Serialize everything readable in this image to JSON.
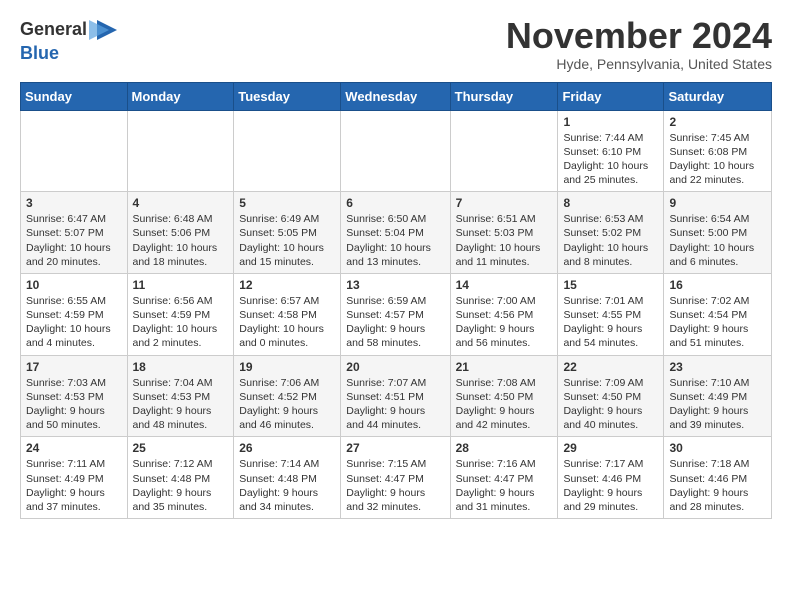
{
  "header": {
    "logo_general": "General",
    "logo_blue": "Blue",
    "month_title": "November 2024",
    "subtitle": "Hyde, Pennsylvania, United States"
  },
  "columns": [
    "Sunday",
    "Monday",
    "Tuesday",
    "Wednesday",
    "Thursday",
    "Friday",
    "Saturday"
  ],
  "weeks": [
    [
      {
        "day": "",
        "content": ""
      },
      {
        "day": "",
        "content": ""
      },
      {
        "day": "",
        "content": ""
      },
      {
        "day": "",
        "content": ""
      },
      {
        "day": "",
        "content": ""
      },
      {
        "day": "1",
        "content": "Sunrise: 7:44 AM\nSunset: 6:10 PM\nDaylight: 10 hours and 25 minutes."
      },
      {
        "day": "2",
        "content": "Sunrise: 7:45 AM\nSunset: 6:08 PM\nDaylight: 10 hours and 22 minutes."
      }
    ],
    [
      {
        "day": "3",
        "content": "Sunrise: 6:47 AM\nSunset: 5:07 PM\nDaylight: 10 hours and 20 minutes."
      },
      {
        "day": "4",
        "content": "Sunrise: 6:48 AM\nSunset: 5:06 PM\nDaylight: 10 hours and 18 minutes."
      },
      {
        "day": "5",
        "content": "Sunrise: 6:49 AM\nSunset: 5:05 PM\nDaylight: 10 hours and 15 minutes."
      },
      {
        "day": "6",
        "content": "Sunrise: 6:50 AM\nSunset: 5:04 PM\nDaylight: 10 hours and 13 minutes."
      },
      {
        "day": "7",
        "content": "Sunrise: 6:51 AM\nSunset: 5:03 PM\nDaylight: 10 hours and 11 minutes."
      },
      {
        "day": "8",
        "content": "Sunrise: 6:53 AM\nSunset: 5:02 PM\nDaylight: 10 hours and 8 minutes."
      },
      {
        "day": "9",
        "content": "Sunrise: 6:54 AM\nSunset: 5:00 PM\nDaylight: 10 hours and 6 minutes."
      }
    ],
    [
      {
        "day": "10",
        "content": "Sunrise: 6:55 AM\nSunset: 4:59 PM\nDaylight: 10 hours and 4 minutes."
      },
      {
        "day": "11",
        "content": "Sunrise: 6:56 AM\nSunset: 4:59 PM\nDaylight: 10 hours and 2 minutes."
      },
      {
        "day": "12",
        "content": "Sunrise: 6:57 AM\nSunset: 4:58 PM\nDaylight: 10 hours and 0 minutes."
      },
      {
        "day": "13",
        "content": "Sunrise: 6:59 AM\nSunset: 4:57 PM\nDaylight: 9 hours and 58 minutes."
      },
      {
        "day": "14",
        "content": "Sunrise: 7:00 AM\nSunset: 4:56 PM\nDaylight: 9 hours and 56 minutes."
      },
      {
        "day": "15",
        "content": "Sunrise: 7:01 AM\nSunset: 4:55 PM\nDaylight: 9 hours and 54 minutes."
      },
      {
        "day": "16",
        "content": "Sunrise: 7:02 AM\nSunset: 4:54 PM\nDaylight: 9 hours and 51 minutes."
      }
    ],
    [
      {
        "day": "17",
        "content": "Sunrise: 7:03 AM\nSunset: 4:53 PM\nDaylight: 9 hours and 50 minutes."
      },
      {
        "day": "18",
        "content": "Sunrise: 7:04 AM\nSunset: 4:53 PM\nDaylight: 9 hours and 48 minutes."
      },
      {
        "day": "19",
        "content": "Sunrise: 7:06 AM\nSunset: 4:52 PM\nDaylight: 9 hours and 46 minutes."
      },
      {
        "day": "20",
        "content": "Sunrise: 7:07 AM\nSunset: 4:51 PM\nDaylight: 9 hours and 44 minutes."
      },
      {
        "day": "21",
        "content": "Sunrise: 7:08 AM\nSunset: 4:50 PM\nDaylight: 9 hours and 42 minutes."
      },
      {
        "day": "22",
        "content": "Sunrise: 7:09 AM\nSunset: 4:50 PM\nDaylight: 9 hours and 40 minutes."
      },
      {
        "day": "23",
        "content": "Sunrise: 7:10 AM\nSunset: 4:49 PM\nDaylight: 9 hours and 39 minutes."
      }
    ],
    [
      {
        "day": "24",
        "content": "Sunrise: 7:11 AM\nSunset: 4:49 PM\nDaylight: 9 hours and 37 minutes."
      },
      {
        "day": "25",
        "content": "Sunrise: 7:12 AM\nSunset: 4:48 PM\nDaylight: 9 hours and 35 minutes."
      },
      {
        "day": "26",
        "content": "Sunrise: 7:14 AM\nSunset: 4:48 PM\nDaylight: 9 hours and 34 minutes."
      },
      {
        "day": "27",
        "content": "Sunrise: 7:15 AM\nSunset: 4:47 PM\nDaylight: 9 hours and 32 minutes."
      },
      {
        "day": "28",
        "content": "Sunrise: 7:16 AM\nSunset: 4:47 PM\nDaylight: 9 hours and 31 minutes."
      },
      {
        "day": "29",
        "content": "Sunrise: 7:17 AM\nSunset: 4:46 PM\nDaylight: 9 hours and 29 minutes."
      },
      {
        "day": "30",
        "content": "Sunrise: 7:18 AM\nSunset: 4:46 PM\nDaylight: 9 hours and 28 minutes."
      }
    ]
  ]
}
